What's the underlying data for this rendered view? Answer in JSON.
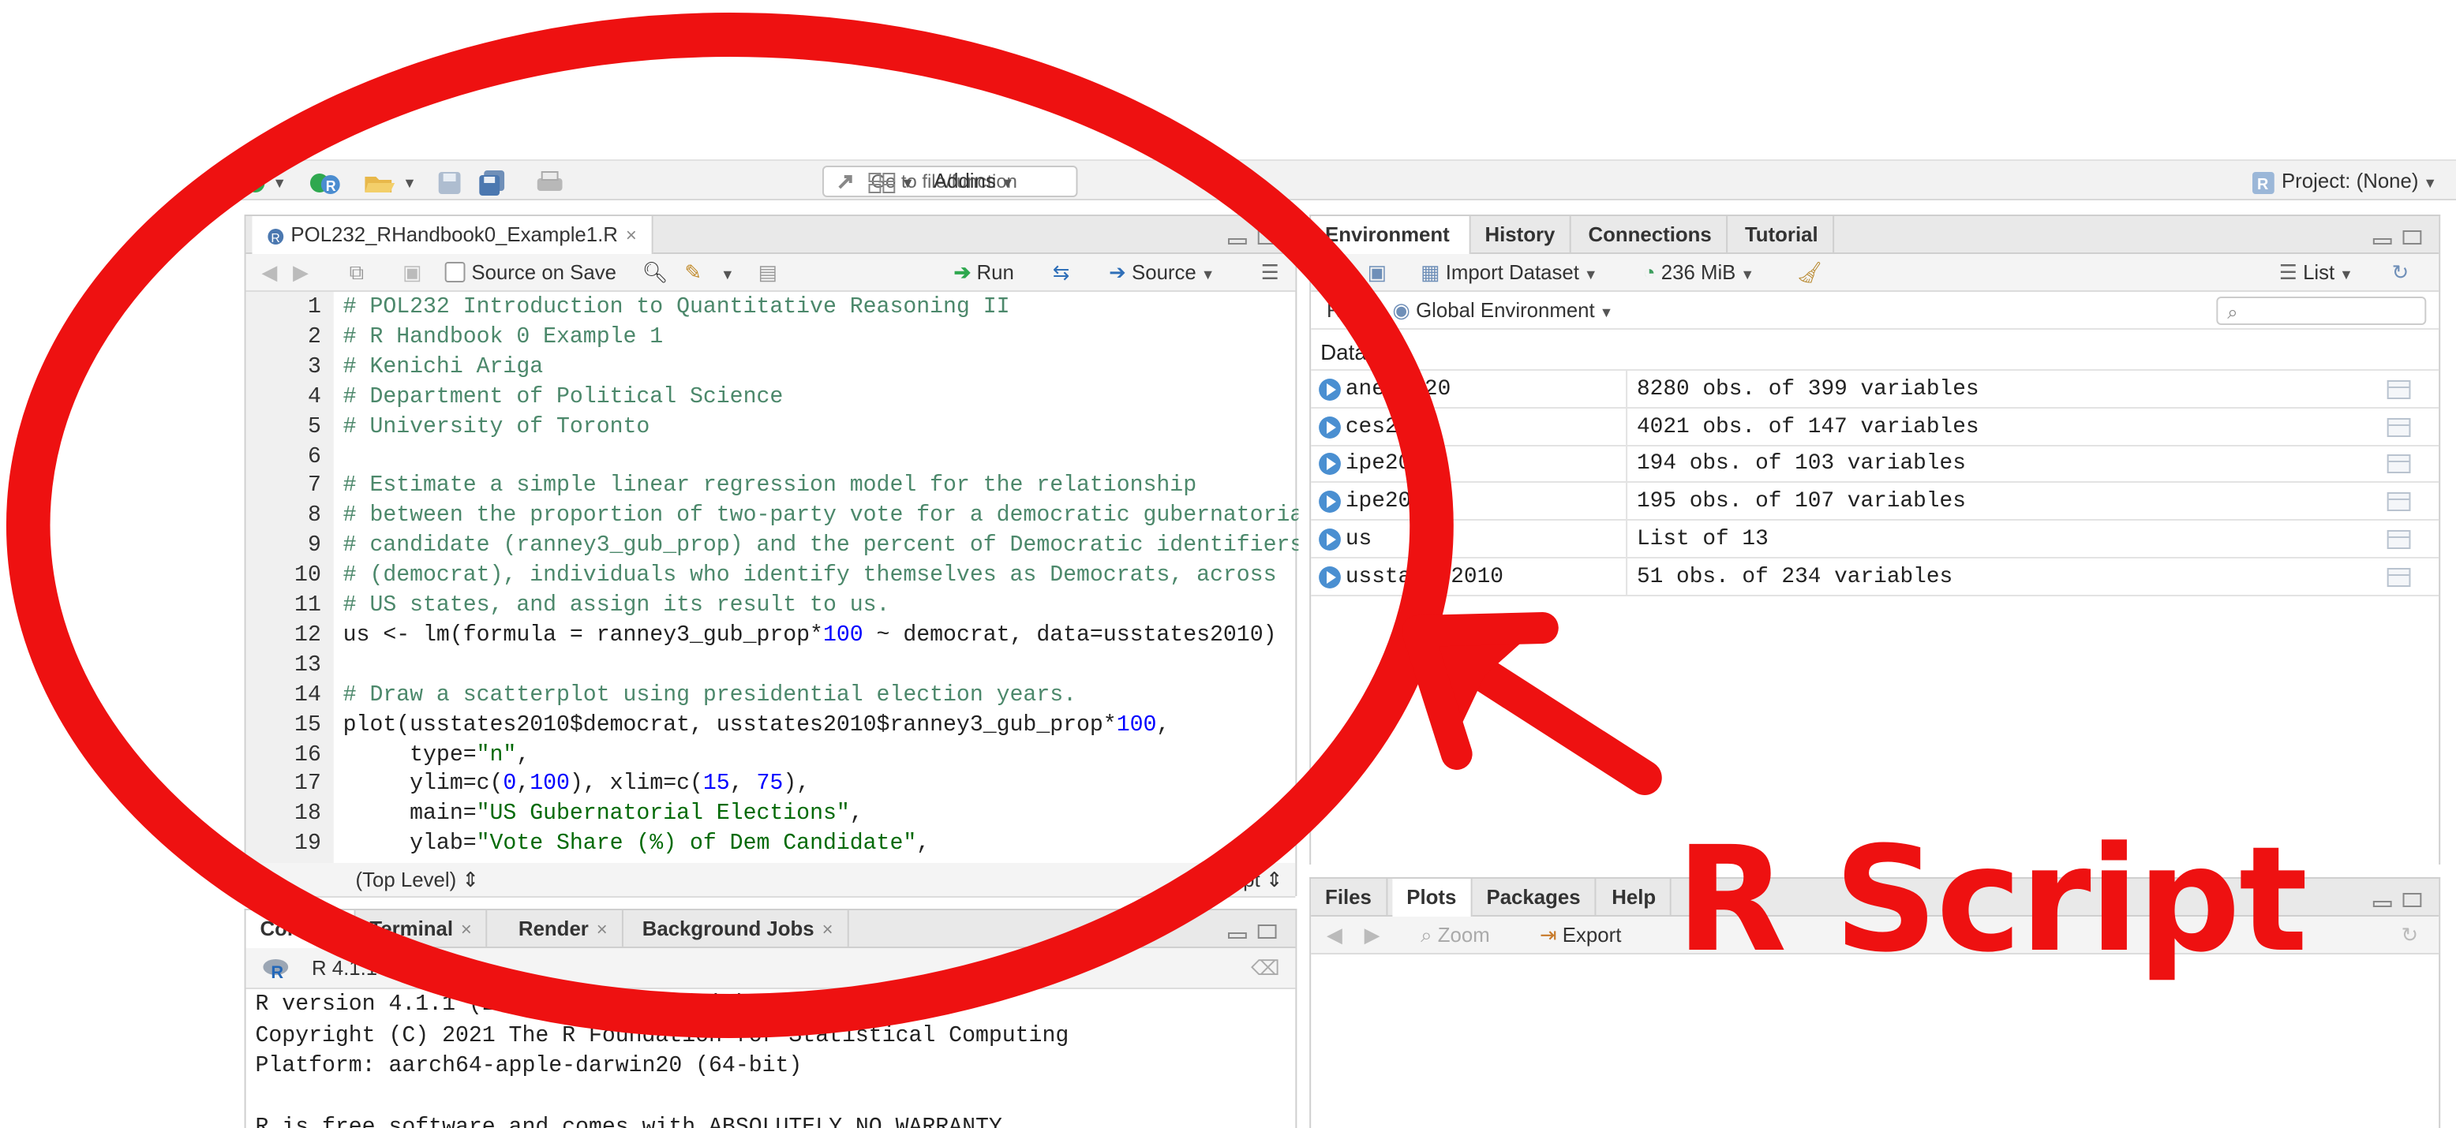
{
  "toolbar": {
    "goto_placeholder": "Go to file/function",
    "addins_label": "Addins",
    "project_label": "Project: (None)"
  },
  "source_pane": {
    "file_tab": "POL232_RHandbook0_Example1.R",
    "source_on_save": "Source on Save",
    "run_label": "Run",
    "source_label": "Source",
    "status_scope": "(Top Level)",
    "status_type": "R Script",
    "line_numbers": [
      "1",
      "2",
      "3",
      "4",
      "5",
      "6",
      "7",
      "8",
      "9",
      "10",
      "11",
      "12",
      "13",
      "14",
      "15",
      "16",
      "17",
      "18",
      "19"
    ],
    "lines": [
      "# POL232 Introduction to Quantitative Reasoning II",
      "# R Handbook 0 Example 1",
      "# Kenichi Ariga",
      "# Department of Political Science",
      "# University of Toronto",
      "",
      "# Estimate a simple linear regression model for the relationship",
      "# between the proportion of two-party vote for a democratic gubernatorial",
      "# candidate (ranney3_gub_prop) and the percent of Democratic identifiers",
      "# (democrat), individuals who identify themselves as Democrats, across",
      "# US states, and assign its result to us.",
      "us <- lm(formula = ranney3_gub_prop*100 ~ democrat, data=usstates2010)",
      "",
      "# Draw a scatterplot using presidential election years.",
      "plot(usstates2010$democrat, usstates2010$ranney3_gub_prop*100,",
      "     type=\"n\",",
      "     ylim=c(0,100), xlim=c(15, 75),",
      "     main=\"US Gubernatorial Elections\",",
      "     ylab=\"Vote Share (%) of Dem Candidate\","
    ]
  },
  "console_pane": {
    "tabs": [
      "Console",
      "Terminal",
      "Render",
      "Background Jobs"
    ],
    "r_version_label": "R 4.1.1 · ~/",
    "lines": [
      "R version 4.1.1 (2021-08-10) -- \"Kick Things\"",
      "Copyright (C) 2021 The R Foundation for Statistical Computing",
      "Platform: aarch64-apple-darwin20 (64-bit)",
      "",
      "R is free software and comes with ABSOLUTELY NO WARRANTY."
    ]
  },
  "env_pane": {
    "tabs": [
      "Environment",
      "History",
      "Connections",
      "Tutorial"
    ],
    "import_dataset": "Import Dataset",
    "memory": "236 MiB",
    "list_view": "List",
    "language": "R",
    "scope": "Global Environment",
    "section": "Data",
    "rows": [
      {
        "name": "anes2020",
        "value": "8280 obs. of 399 variables"
      },
      {
        "name": "ces2019",
        "value": "4021 obs. of 147 variables"
      },
      {
        "name": "ipe2010",
        "value": "194 obs. of 103 variables"
      },
      {
        "name": "ipe2015",
        "value": "195 obs. of 107 variables"
      },
      {
        "name": "us",
        "value": "List of  13"
      },
      {
        "name": "usstates2010",
        "value": "51 obs. of 234 variables"
      }
    ]
  },
  "files_pane": {
    "tabs": [
      "Files",
      "Plots",
      "Packages",
      "Help"
    ],
    "zoom": "Zoom",
    "export": "Export"
  },
  "annotation": {
    "label": "R Script",
    "color": "#ee1111"
  }
}
